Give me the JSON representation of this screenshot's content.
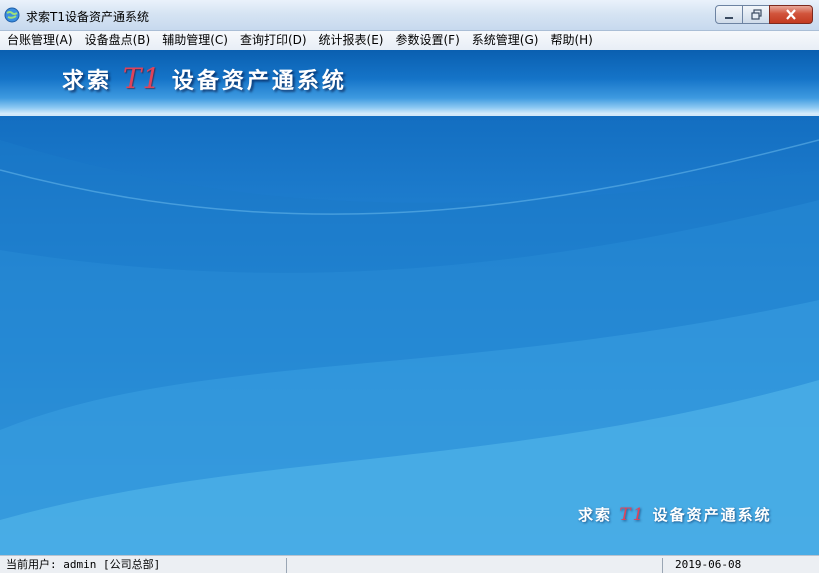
{
  "window": {
    "title": "求索T1设备资产通系统",
    "app_icon": "globe-icon",
    "controls": [
      "minimize-icon",
      "restore-icon",
      "close-icon"
    ]
  },
  "menu": [
    "台账管理(A)",
    "设备盘点(B)",
    "辅助管理(C)",
    "查询打印(D)",
    "统计报表(E)",
    "参数设置(F)",
    "系统管理(G)",
    "帮助(H)"
  ],
  "banner": {
    "prefix": "求索",
    "mid": "T1",
    "suffix": "设备资产通系统"
  },
  "corner_logo": {
    "prefix": "求索",
    "mid": "T1",
    "suffix": "设备资产通系统"
  },
  "status": {
    "user": "当前用户: admin [公司总部]",
    "middle": "",
    "date": "2019-06-08"
  },
  "colors": {
    "accent": "#e0435a",
    "background_blue": "#1d7ccd"
  }
}
